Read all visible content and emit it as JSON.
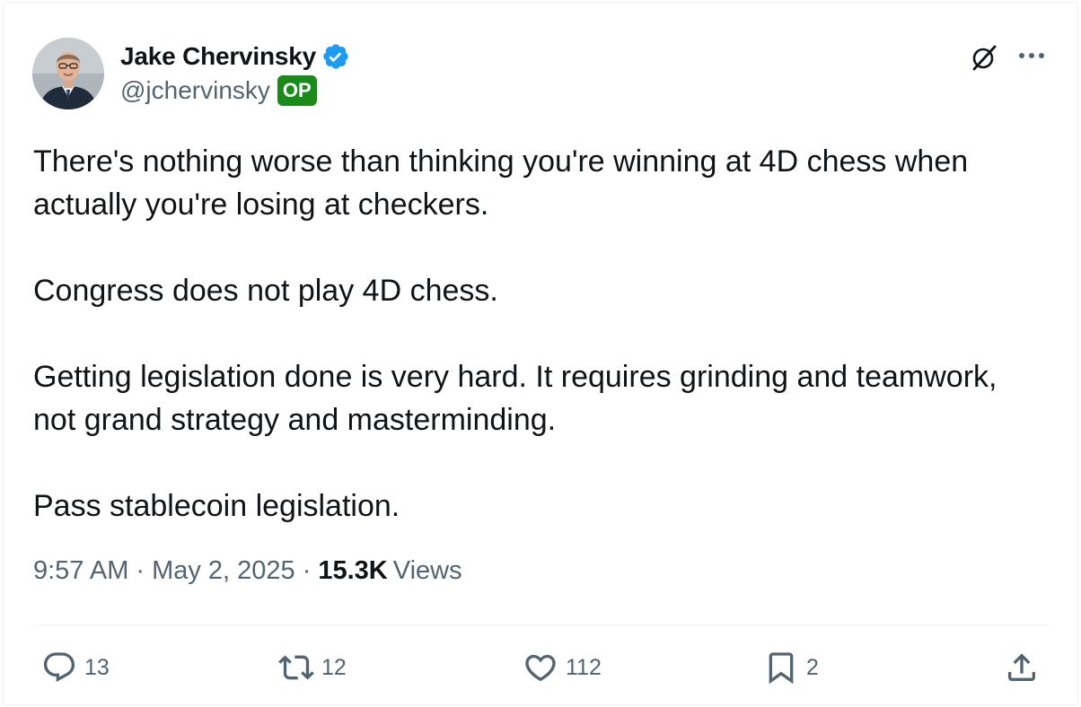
{
  "author": {
    "display_name": "Jake Chervinsky",
    "handle": "@jchervinsky",
    "op_badge": "OP",
    "verified": true,
    "verified_color": "#1d9bf0"
  },
  "tweet": {
    "paragraphs": [
      "There's nothing worse than thinking you're winning at 4D chess when actually you're losing at checkers.",
      "Congress does not play 4D chess.",
      "Getting legislation done is very hard. It requires grinding and teamwork, not grand strategy and masterminding.",
      "Pass stablecoin legislation."
    ]
  },
  "meta": {
    "time": "9:57 AM",
    "separator": "·",
    "date": "May 2, 2025",
    "views_count": "15.3K",
    "views_label": "Views"
  },
  "actions": {
    "reply_count": "13",
    "repost_count": "12",
    "like_count": "112",
    "bookmark_count": "2"
  },
  "icons": {
    "grok": "grok-slash-icon",
    "more": "more-dots-icon",
    "reply": "reply-bubble-icon",
    "repost": "repost-arrows-icon",
    "like": "heart-icon",
    "bookmark": "bookmark-icon",
    "share": "share-upload-icon"
  },
  "colors": {
    "text_primary": "#0f1419",
    "text_secondary": "#536471",
    "op_badge_bg": "#1a8a1a",
    "divider": "#eff3f4"
  }
}
